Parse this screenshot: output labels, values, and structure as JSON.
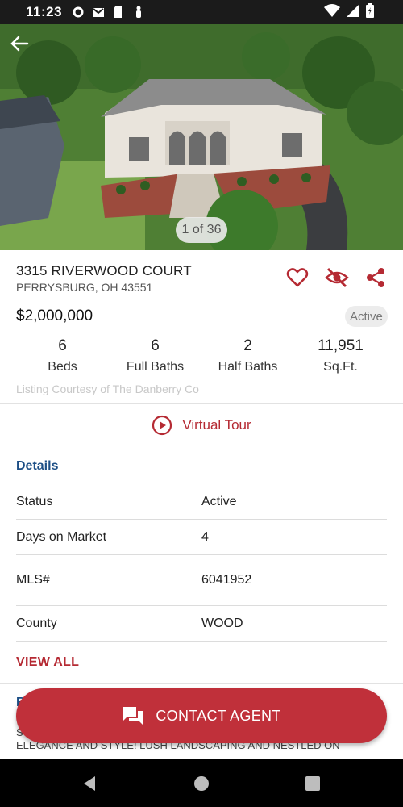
{
  "status_bar": {
    "time": "11:23"
  },
  "listing": {
    "photo_counter": "1 of 36",
    "address": "3315 RIVERWOOD COURT",
    "city_state_zip": "PERRYSBURG, OH 43551",
    "price": "$2,000,000",
    "status_badge": "Active",
    "stats": [
      {
        "value": "6",
        "label": "Beds"
      },
      {
        "value": "6",
        "label": "Full Baths"
      },
      {
        "value": "2",
        "label": "Half Baths"
      },
      {
        "value": "11,951",
        "label": "Sq.Ft."
      }
    ],
    "courtesy": "Listing Courtesy of The Danberry Co"
  },
  "virtual_tour": {
    "label": "Virtual Tour"
  },
  "details": {
    "title": "Details",
    "rows": [
      {
        "key": "Status",
        "value": "Active"
      },
      {
        "key": "Days on Market",
        "value": "4"
      },
      {
        "key": "MLS#",
        "value": "6041952"
      },
      {
        "key": "County",
        "value": "WOOD"
      }
    ],
    "view_all": "VIEW ALL"
  },
  "remarks": {
    "title": "R",
    "text": "S THIS HOME HAS IT ALL! GRAND ENTRY AND EVERY ROOM HAS ELEGANCE AND STYLE! LUSH LANDSCAPING AND NESTLED ON"
  },
  "contact_button": {
    "label": "CONTACT AGENT"
  },
  "colors": {
    "accent_red": "#c0303a",
    "section_blue": "#1d4f86"
  },
  "icons": {
    "back": "back-arrow-icon",
    "favorite": "heart-outline-icon",
    "hide": "eye-off-icon",
    "share": "share-icon",
    "play": "play-circle-icon",
    "chat": "chat-icon"
  }
}
